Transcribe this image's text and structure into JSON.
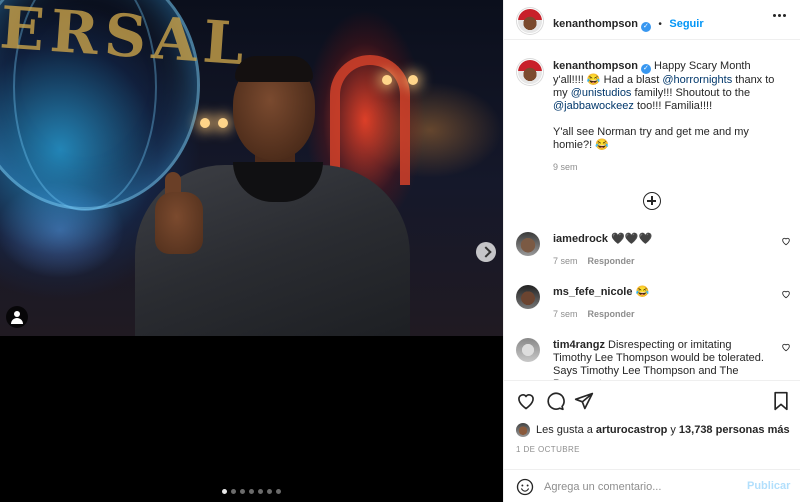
{
  "media": {
    "slides": 7,
    "active_slide": 1
  },
  "header": {
    "username": "kenanthompson",
    "follow_separator": "•",
    "follow_label": "Seguir"
  },
  "caption": {
    "username": "kenanthompson",
    "segments": {
      "t1": " Happy Scary Month y'all!!!! 😂 Had a blast ",
      "m1": "@horrornights",
      "t2": " thanx to my ",
      "m2": "@unistudios",
      "t3": " family!!! Shoutout to the ",
      "m3": "@jabbawockeez",
      "t4": " too!!! Familia!!!!",
      "p2": "Y'all see Norman try and get me and my homie?! 😂"
    },
    "time": "9 sem"
  },
  "comments": [
    {
      "username": "iamedrock",
      "text": " 🖤🖤🖤",
      "time": "7 sem",
      "reply": "Responder"
    },
    {
      "username": "ms_fefe_nicole",
      "text": " 😂",
      "time": "7 sem",
      "reply": "Responder"
    },
    {
      "username": "tim4rangz",
      "text": " Disrespecting or imitating Timothy Lee Thompson would be tolerated. Says Timothy Lee Thompson and The Powers at"
    }
  ],
  "likes": {
    "prefix": "Les gusta a ",
    "user": "arturocastrop",
    "middle": " y ",
    "count": "13,738 personas más"
  },
  "date": "1 DE OCTUBRE",
  "add_comment": {
    "placeholder": "Agrega un comentario...",
    "post_label": "Publicar"
  },
  "colors": {
    "link_blue": "#0095f6",
    "mention": "#00376b",
    "muted": "#8e8e8e",
    "post_disabled": "#b2dffc"
  }
}
